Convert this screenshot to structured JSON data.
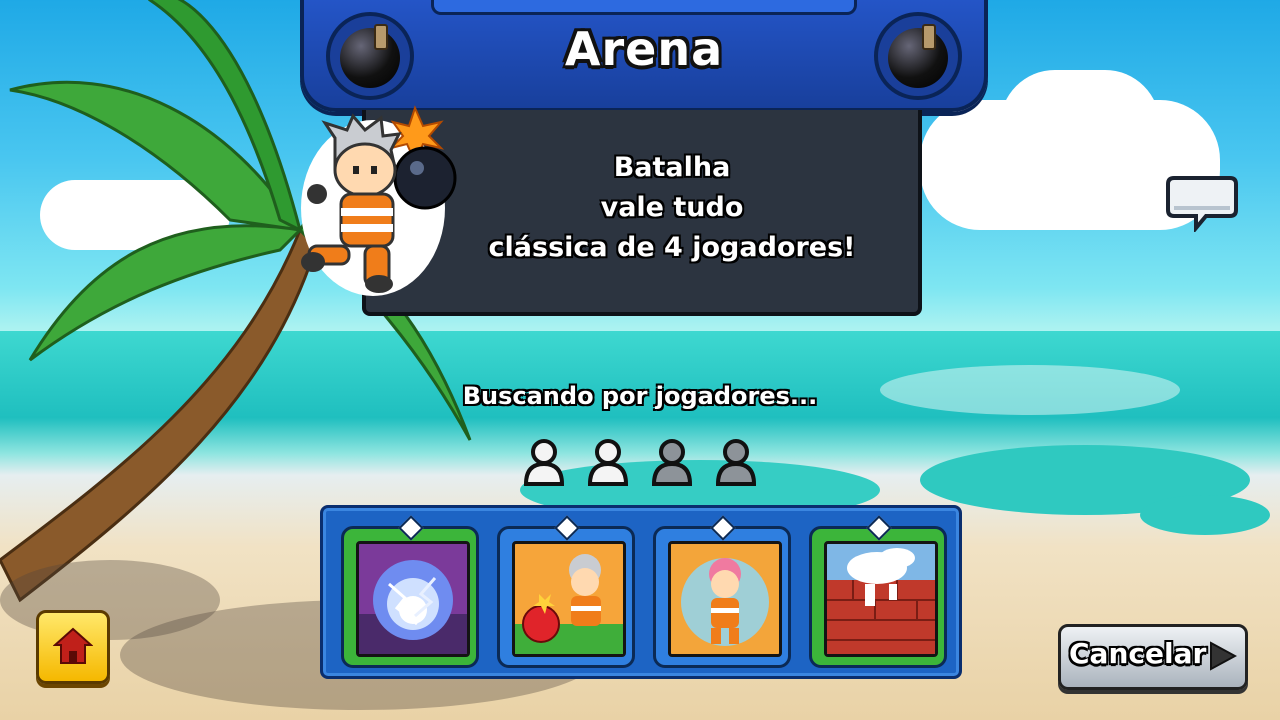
{
  "header": {
    "title": "Arena",
    "left_icon": "bomb-icon",
    "right_icon": "bomb-icon"
  },
  "mode": {
    "description_lines": [
      "Batalha",
      "vale tudo",
      "clássica de 4 jogadores!"
    ],
    "character_icon": "bomber-character-icon"
  },
  "matchmaking": {
    "status": "Buscando por jogadores...",
    "player_slots": [
      {
        "state": "found",
        "icon": "player-silhouette-icon"
      },
      {
        "state": "found",
        "icon": "player-silhouette-icon"
      },
      {
        "state": "waiting",
        "icon": "player-silhouette-icon"
      },
      {
        "state": "waiting",
        "icon": "player-silhouette-icon"
      }
    ]
  },
  "powerups": [
    {
      "icon": "energy-shield-orb-icon",
      "rarity": "green",
      "gem": "diamond"
    },
    {
      "icon": "bomber-throw-bomb-icon",
      "rarity": "blue",
      "gem": "triangle"
    },
    {
      "icon": "bubble-shield-character-icon",
      "rarity": "blue",
      "gem": "triangle"
    },
    {
      "icon": "brick-wall-explosion-icon",
      "rarity": "green",
      "gem": "diamond"
    }
  ],
  "buttons": {
    "home_icon": "home-icon",
    "cancel_label": "Cancelar",
    "cancel_icon": "arrow-right-icon",
    "chat_icon": "chat-bubble-icon"
  },
  "colors": {
    "green_card": "#3cb53a",
    "blue_card": "#2f7fe0",
    "panel_blue": "#1d64c4",
    "home_yellow": "#f5c400"
  }
}
